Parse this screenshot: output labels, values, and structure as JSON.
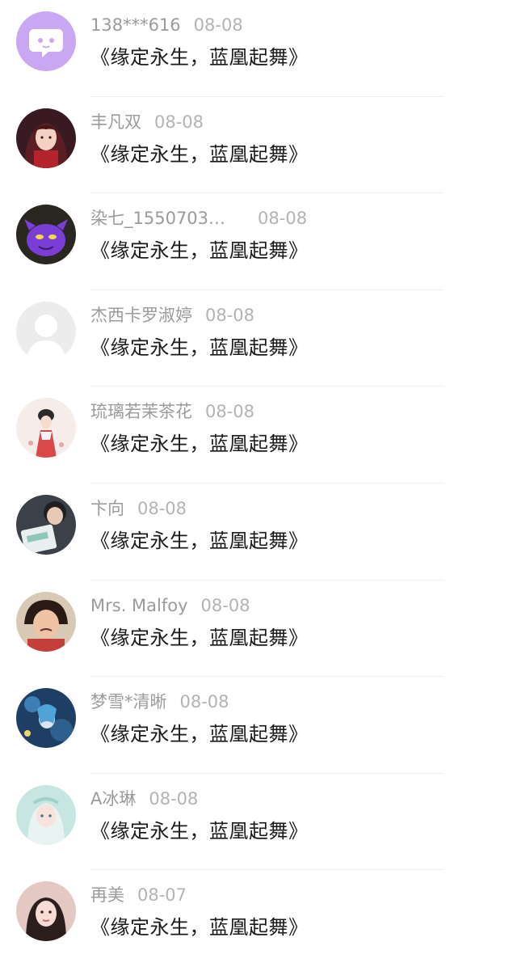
{
  "comments": [
    {
      "user": "138***616",
      "date": "08-08",
      "text": "《缘定永生，蓝凰起舞》",
      "avatar": "default-chat-icon",
      "avatar_color": "#c9a7f2"
    },
    {
      "user": "丰凡双",
      "date": "08-08",
      "text": "《缘定永生，蓝凰起舞》",
      "avatar": "anime-girl-red",
      "avatar_color": "#6b2230"
    },
    {
      "user": "染七_1550703…",
      "date": "08-08",
      "text": "《缘定永生，蓝凰起舞》",
      "avatar": "purple-monster",
      "avatar_color": "#7a3ed6"
    },
    {
      "user": "杰西卡罗淑婷",
      "date": "08-08",
      "text": "《缘定永生，蓝凰起舞》",
      "avatar": "default-person-icon",
      "avatar_color": "#ececec"
    },
    {
      "user": "琉璃若茉茶花",
      "date": "08-08",
      "text": "《缘定永生，蓝凰起舞》",
      "avatar": "hanfu-girl",
      "avatar_color": "#f4e2de"
    },
    {
      "user": "卞向",
      "date": "08-08",
      "text": "《缘定永生，蓝凰起舞》",
      "avatar": "woman-with-book",
      "avatar_color": "#444850"
    },
    {
      "user": "Mrs. Malfoy",
      "date": "08-08",
      "text": "《缘定永生，蓝凰起舞》",
      "avatar": "crying-child",
      "avatar_color": "#c95a4a"
    },
    {
      "user": "梦雪*清晰",
      "date": "08-08",
      "text": "《缘定永生，蓝凰起舞》",
      "avatar": "blue-art-girl",
      "avatar_color": "#2a5c8c"
    },
    {
      "user": "A冰琳",
      "date": "08-08",
      "text": "《缘定永生，蓝凰起舞》",
      "avatar": "pastel-anime-girl",
      "avatar_color": "#b9e0dc"
    },
    {
      "user": "再美",
      "date": "08-07",
      "text": "《缘定永生，蓝凰起舞》",
      "avatar": "selfie-girl",
      "avatar_color": "#d9b3b0"
    }
  ]
}
